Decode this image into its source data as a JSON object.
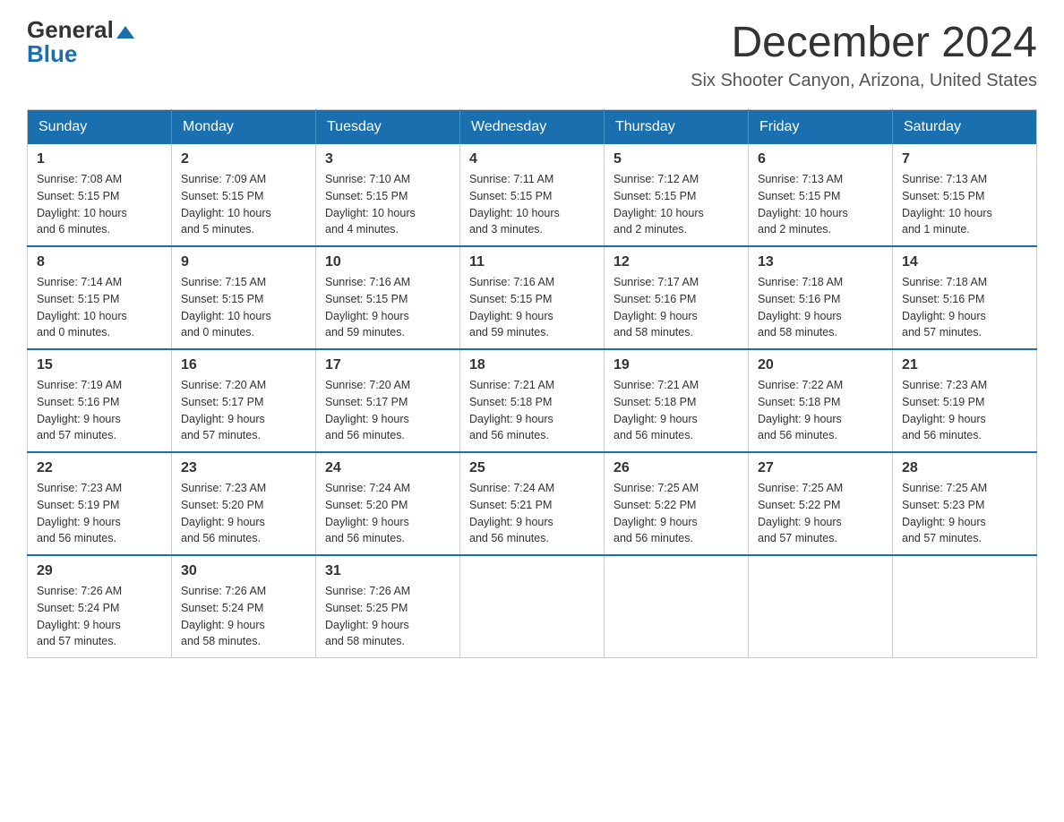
{
  "header": {
    "logo_general": "General",
    "logo_blue": "Blue",
    "month_title": "December 2024",
    "location": "Six Shooter Canyon, Arizona, United States"
  },
  "weekdays": [
    "Sunday",
    "Monday",
    "Tuesday",
    "Wednesday",
    "Thursday",
    "Friday",
    "Saturday"
  ],
  "weeks": [
    [
      {
        "day": "1",
        "info": "Sunrise: 7:08 AM\nSunset: 5:15 PM\nDaylight: 10 hours\nand 6 minutes."
      },
      {
        "day": "2",
        "info": "Sunrise: 7:09 AM\nSunset: 5:15 PM\nDaylight: 10 hours\nand 5 minutes."
      },
      {
        "day": "3",
        "info": "Sunrise: 7:10 AM\nSunset: 5:15 PM\nDaylight: 10 hours\nand 4 minutes."
      },
      {
        "day": "4",
        "info": "Sunrise: 7:11 AM\nSunset: 5:15 PM\nDaylight: 10 hours\nand 3 minutes."
      },
      {
        "day": "5",
        "info": "Sunrise: 7:12 AM\nSunset: 5:15 PM\nDaylight: 10 hours\nand 2 minutes."
      },
      {
        "day": "6",
        "info": "Sunrise: 7:13 AM\nSunset: 5:15 PM\nDaylight: 10 hours\nand 2 minutes."
      },
      {
        "day": "7",
        "info": "Sunrise: 7:13 AM\nSunset: 5:15 PM\nDaylight: 10 hours\nand 1 minute."
      }
    ],
    [
      {
        "day": "8",
        "info": "Sunrise: 7:14 AM\nSunset: 5:15 PM\nDaylight: 10 hours\nand 0 minutes."
      },
      {
        "day": "9",
        "info": "Sunrise: 7:15 AM\nSunset: 5:15 PM\nDaylight: 10 hours\nand 0 minutes."
      },
      {
        "day": "10",
        "info": "Sunrise: 7:16 AM\nSunset: 5:15 PM\nDaylight: 9 hours\nand 59 minutes."
      },
      {
        "day": "11",
        "info": "Sunrise: 7:16 AM\nSunset: 5:15 PM\nDaylight: 9 hours\nand 59 minutes."
      },
      {
        "day": "12",
        "info": "Sunrise: 7:17 AM\nSunset: 5:16 PM\nDaylight: 9 hours\nand 58 minutes."
      },
      {
        "day": "13",
        "info": "Sunrise: 7:18 AM\nSunset: 5:16 PM\nDaylight: 9 hours\nand 58 minutes."
      },
      {
        "day": "14",
        "info": "Sunrise: 7:18 AM\nSunset: 5:16 PM\nDaylight: 9 hours\nand 57 minutes."
      }
    ],
    [
      {
        "day": "15",
        "info": "Sunrise: 7:19 AM\nSunset: 5:16 PM\nDaylight: 9 hours\nand 57 minutes."
      },
      {
        "day": "16",
        "info": "Sunrise: 7:20 AM\nSunset: 5:17 PM\nDaylight: 9 hours\nand 57 minutes."
      },
      {
        "day": "17",
        "info": "Sunrise: 7:20 AM\nSunset: 5:17 PM\nDaylight: 9 hours\nand 56 minutes."
      },
      {
        "day": "18",
        "info": "Sunrise: 7:21 AM\nSunset: 5:18 PM\nDaylight: 9 hours\nand 56 minutes."
      },
      {
        "day": "19",
        "info": "Sunrise: 7:21 AM\nSunset: 5:18 PM\nDaylight: 9 hours\nand 56 minutes."
      },
      {
        "day": "20",
        "info": "Sunrise: 7:22 AM\nSunset: 5:18 PM\nDaylight: 9 hours\nand 56 minutes."
      },
      {
        "day": "21",
        "info": "Sunrise: 7:23 AM\nSunset: 5:19 PM\nDaylight: 9 hours\nand 56 minutes."
      }
    ],
    [
      {
        "day": "22",
        "info": "Sunrise: 7:23 AM\nSunset: 5:19 PM\nDaylight: 9 hours\nand 56 minutes."
      },
      {
        "day": "23",
        "info": "Sunrise: 7:23 AM\nSunset: 5:20 PM\nDaylight: 9 hours\nand 56 minutes."
      },
      {
        "day": "24",
        "info": "Sunrise: 7:24 AM\nSunset: 5:20 PM\nDaylight: 9 hours\nand 56 minutes."
      },
      {
        "day": "25",
        "info": "Sunrise: 7:24 AM\nSunset: 5:21 PM\nDaylight: 9 hours\nand 56 minutes."
      },
      {
        "day": "26",
        "info": "Sunrise: 7:25 AM\nSunset: 5:22 PM\nDaylight: 9 hours\nand 56 minutes."
      },
      {
        "day": "27",
        "info": "Sunrise: 7:25 AM\nSunset: 5:22 PM\nDaylight: 9 hours\nand 57 minutes."
      },
      {
        "day": "28",
        "info": "Sunrise: 7:25 AM\nSunset: 5:23 PM\nDaylight: 9 hours\nand 57 minutes."
      }
    ],
    [
      {
        "day": "29",
        "info": "Sunrise: 7:26 AM\nSunset: 5:24 PM\nDaylight: 9 hours\nand 57 minutes."
      },
      {
        "day": "30",
        "info": "Sunrise: 7:26 AM\nSunset: 5:24 PM\nDaylight: 9 hours\nand 58 minutes."
      },
      {
        "day": "31",
        "info": "Sunrise: 7:26 AM\nSunset: 5:25 PM\nDaylight: 9 hours\nand 58 minutes."
      },
      null,
      null,
      null,
      null
    ]
  ]
}
